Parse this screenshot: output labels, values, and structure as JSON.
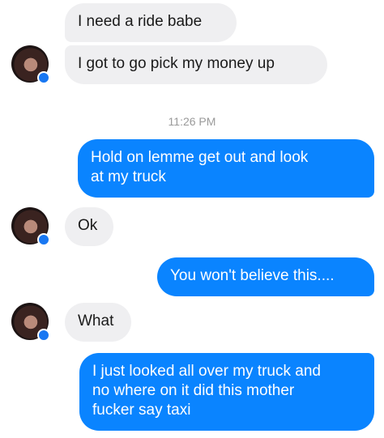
{
  "conversation": {
    "messages": [
      {
        "from": "them",
        "text": "I need a ride babe"
      },
      {
        "from": "them",
        "text": "I got to go pick my money up"
      },
      {
        "from": "me",
        "lines": [
          "Hold on lemme get out and look",
          "at my truck"
        ]
      },
      {
        "from": "them",
        "text": "Ok"
      },
      {
        "from": "me",
        "text": "You won't believe this...."
      },
      {
        "from": "them",
        "text": "What"
      },
      {
        "from": "me",
        "lines": [
          "I just looked all over my truck and",
          "no where on it did this mother",
          "fucker say taxi"
        ]
      }
    ],
    "timestamp": "11:26 PM"
  },
  "colors": {
    "outgoing_bubble": "#0a84ff",
    "incoming_bubble": "#efeff1",
    "messenger_badge": "#1877f2"
  },
  "icons": {
    "avatar": "contact-avatar",
    "badge": "messenger-badge-icon"
  }
}
